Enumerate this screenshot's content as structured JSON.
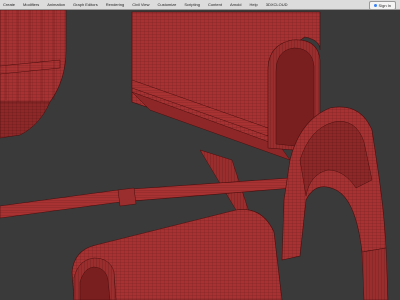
{
  "menubar": {
    "items": [
      {
        "label": "Create"
      },
      {
        "label": "Modifiers"
      },
      {
        "label": "Animation"
      },
      {
        "label": "Graph Editors"
      },
      {
        "label": "Rendering"
      },
      {
        "label": "Civil View"
      },
      {
        "label": "Customize"
      },
      {
        "label": "Scripting"
      },
      {
        "label": "Content"
      },
      {
        "label": "Arnold"
      },
      {
        "label": "Help"
      },
      {
        "label": "3DXCLOUD"
      }
    ],
    "signin_label": "Sign In"
  },
  "viewport": {
    "background": "#3a3a3a",
    "mesh_color": "#a83232",
    "wire_color": "#5a1212",
    "highlight_color": "#c44545"
  }
}
